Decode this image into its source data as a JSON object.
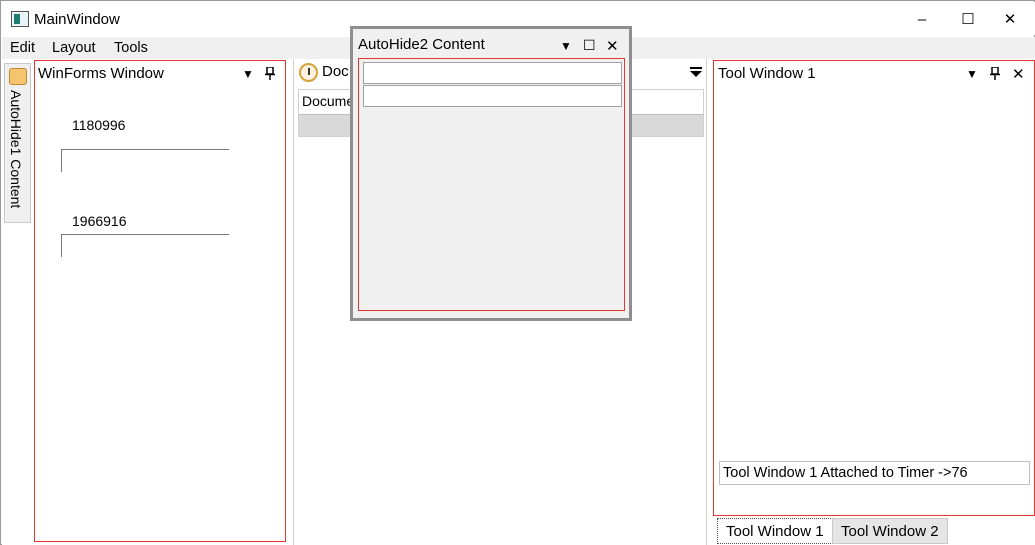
{
  "window": {
    "title": "MainWindow",
    "minimize": "–",
    "maximize": "☐",
    "close": "✕"
  },
  "menu": [
    "Edit",
    "Layout",
    "Tools"
  ],
  "autohide_left": {
    "label": "AutoHide1 Content"
  },
  "winforms": {
    "title": "WinForms Window",
    "value1": "1180996",
    "value2": "1966916",
    "menu_glyph": "▼",
    "pin_glyph": "📌"
  },
  "document": {
    "tab_title": "Doc",
    "list_header": "Docume",
    "menu_glyph": "⯆"
  },
  "autohide2": {
    "title": "AutoHide2 Content",
    "input1": "",
    "input2": "",
    "menu_glyph": "▼",
    "max_glyph": "☐",
    "close_glyph": "✕"
  },
  "tool_window": {
    "title": "Tool Window 1",
    "status": "Tool Window 1 Attached to Timer ->76",
    "menu_glyph": "▼",
    "pin_glyph": "📌",
    "close_glyph": "✕"
  },
  "tabs": [
    "Tool Window 1",
    "Tool Window 2"
  ],
  "colors": {
    "pane_border": "#e0382f",
    "menu_bg": "#f0f0f0"
  }
}
